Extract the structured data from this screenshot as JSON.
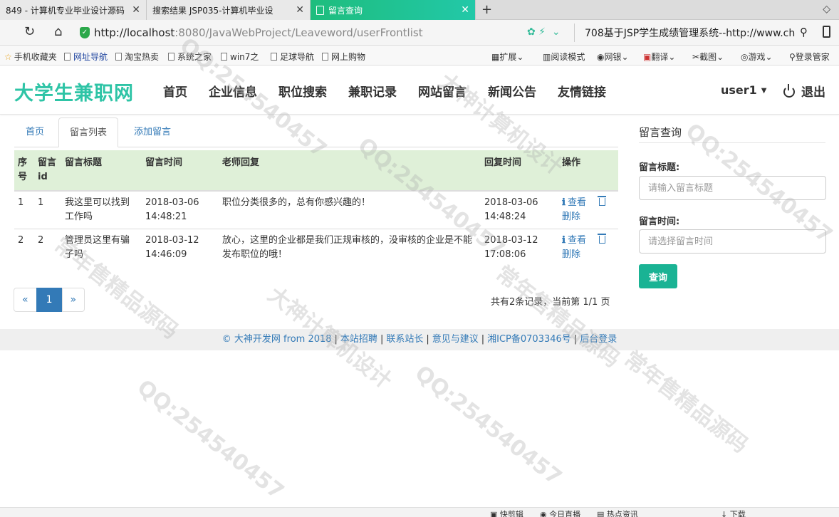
{
  "browser": {
    "tabs": [
      {
        "title": "849 - 计算机专业毕业设计源码"
      },
      {
        "title": "搜索结果 JSP035-计算机毕业设"
      },
      {
        "title": "留言查询"
      }
    ],
    "new_tab_label": "+",
    "url_host": "http://localhost",
    "url_rest": ":8080/JavaWebProject/Leaveword/userFrontlist",
    "search_text": "708基于JSP学生成绩管理系统--http://www.ch",
    "bookmarks": [
      "手机收藏夹",
      "网址导航",
      "淘宝热卖",
      "系统之家",
      "win7之",
      "足球导航",
      "网上购物"
    ],
    "toolbar_items": [
      "扩展",
      "阅读模式",
      "网银",
      "翻译",
      "截图",
      "游戏",
      "登录管家"
    ]
  },
  "site": {
    "brand": "大学生兼职网",
    "nav": [
      "首页",
      "企业信息",
      "职位搜索",
      "兼职记录",
      "网站留言",
      "新闻公告",
      "友情链接"
    ],
    "user": "user1",
    "logout": "退出"
  },
  "subtabs": [
    "首页",
    "留言列表",
    "添加留言"
  ],
  "table": {
    "headers": [
      "序号",
      "留言id",
      "留言标题",
      "留言时间",
      "老师回复",
      "回复时间",
      "操作"
    ],
    "rows": [
      {
        "no": "1",
        "id": "1",
        "title": "我这里可以找到工作吗",
        "time": "2018-03-06 14:48:21",
        "reply": "职位分类很多的，总有你感兴趣的！",
        "reply_time": "2018-03-06 14:48:24",
        "view": "查看",
        "delete": "删除"
      },
      {
        "no": "2",
        "id": "2",
        "title": "管理员这里有骗子吗",
        "time": "2018-03-12 14:46:09",
        "reply": "放心，这里的企业都是我们正规审核的，没审核的企业是不能发布职位的哦！",
        "reply_time": "2018-03-12 17:08:06",
        "view": "查看",
        "delete": "删除"
      }
    ]
  },
  "pagination": {
    "prev": "«",
    "current": "1",
    "next": "»",
    "info": "共有2条记录，当前第 1/1 页"
  },
  "sidebar": {
    "title": "留言查询",
    "title_label": "留言标题:",
    "title_placeholder": "请输入留言标题",
    "time_label": "留言时间:",
    "time_placeholder": "请选择留言时间",
    "query_button": "查询"
  },
  "footer": [
    "© 大神开发网 from 2018",
    "本站招聘",
    "联系站长",
    "意见与建议",
    "湘ICP备0703346号",
    "后台登录"
  ],
  "statusbar": [
    "快剪辑",
    "今日直播",
    "热点资讯",
    "下载"
  ],
  "watermark": [
    "QQ:254540457",
    "大神计算机设计",
    "常年售精品源码"
  ]
}
